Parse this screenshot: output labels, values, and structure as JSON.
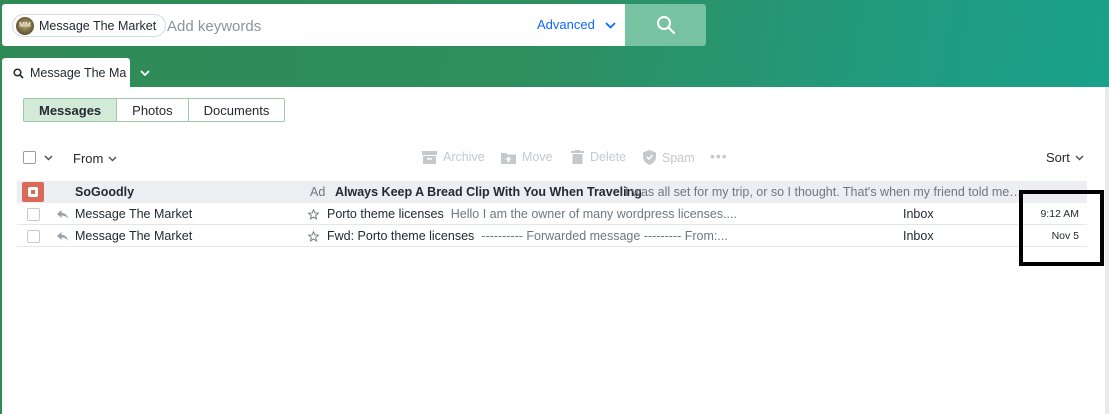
{
  "search": {
    "pill_label": "Message The Market",
    "pill_avatar_text": "MM",
    "placeholder": "Add keywords",
    "advanced_label": "Advanced"
  },
  "tab": {
    "label": "Message The Ma"
  },
  "filters": {
    "messages": "Messages",
    "photos": "Photos",
    "documents": "Documents",
    "active": "Messages"
  },
  "toolbar": {
    "from_label": "From",
    "archive": "Archive",
    "move": "Move",
    "delete": "Delete",
    "spam": "Spam",
    "more": "•••",
    "sort": "Sort"
  },
  "ad": {
    "sender": "SoGoodly",
    "tag": "Ad",
    "subject": "Always Keep A Bread Clip With You When Traveling",
    "snippet": "I was all set for my trip, or so I thought. That's when my friend told me to al..."
  },
  "messages": [
    {
      "sender": "Message The Market",
      "subject": "Porto theme licenses",
      "snippet": "Hello I am the owner of many wordpress licenses....",
      "folder": "Inbox",
      "date": "9:12 AM"
    },
    {
      "sender": "Message The Market",
      "subject": "Fwd: Porto theme licenses",
      "snippet": "---------- Forwarded message --------- From:...",
      "folder": "Inbox",
      "date": "Nov 5"
    }
  ],
  "colors": {
    "accent_blue": "#0f69ff",
    "search_button": "#76c2a1",
    "active_filter_bg": "#d3ead8",
    "ad_row_bg": "#eceef1",
    "highlight_border": "#000000"
  }
}
